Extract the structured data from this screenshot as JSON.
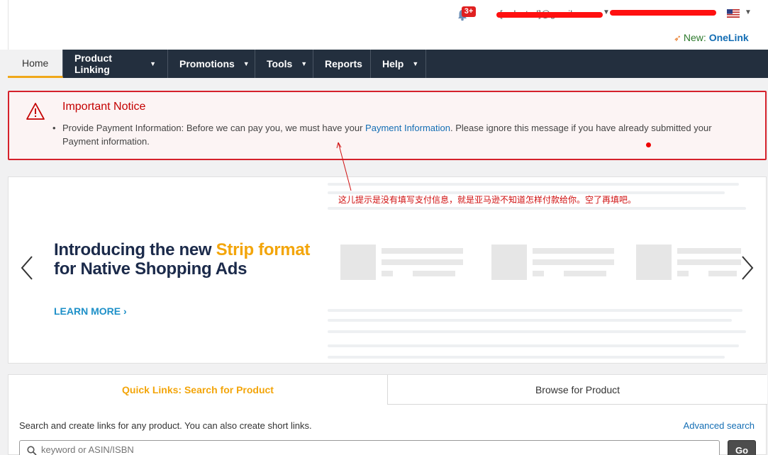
{
  "header": {
    "notification_badge": "3+",
    "email": "[redacted]@gmail.com",
    "onelink_prefix": "New:",
    "onelink_label": "OneLink",
    "flag_icon": "us-flag-icon"
  },
  "nav": {
    "items": [
      {
        "label": "Home",
        "active": true
      },
      {
        "label": "Product Linking"
      },
      {
        "label": "Promotions"
      },
      {
        "label": "Tools"
      },
      {
        "label": "Reports"
      },
      {
        "label": "Help"
      }
    ]
  },
  "notice": {
    "title": "Important Notice",
    "text_before": "Provide Payment Information: Before we can pay you, we must have your ",
    "link": "Payment Information",
    "text_after": ". Please ignore this message if you have already submitted your Payment information."
  },
  "annotation": {
    "text": "这儿提示是没有填写支付信息，就是亚马逊不知道怎样付款给你。空了再填吧。"
  },
  "carousel": {
    "title_part1": "Introducing the new ",
    "title_highlight": "Strip format",
    "title_part2": "for Native Shopping Ads",
    "cta": "LEARN MORE ›"
  },
  "quick_links": {
    "tab_active": "Quick Links: Search for Product",
    "tab_inactive": "Browse for Product",
    "description": "Search and create links for any product. You can also create short links.",
    "advanced_search": "Advanced search",
    "search_placeholder": "keyword or ASIN/ISBN",
    "go_label": "Go"
  },
  "colors": {
    "nav_bg": "#232f3e",
    "accent": "#f3a50a",
    "link": "#146eb4",
    "error": "#d5212b"
  }
}
